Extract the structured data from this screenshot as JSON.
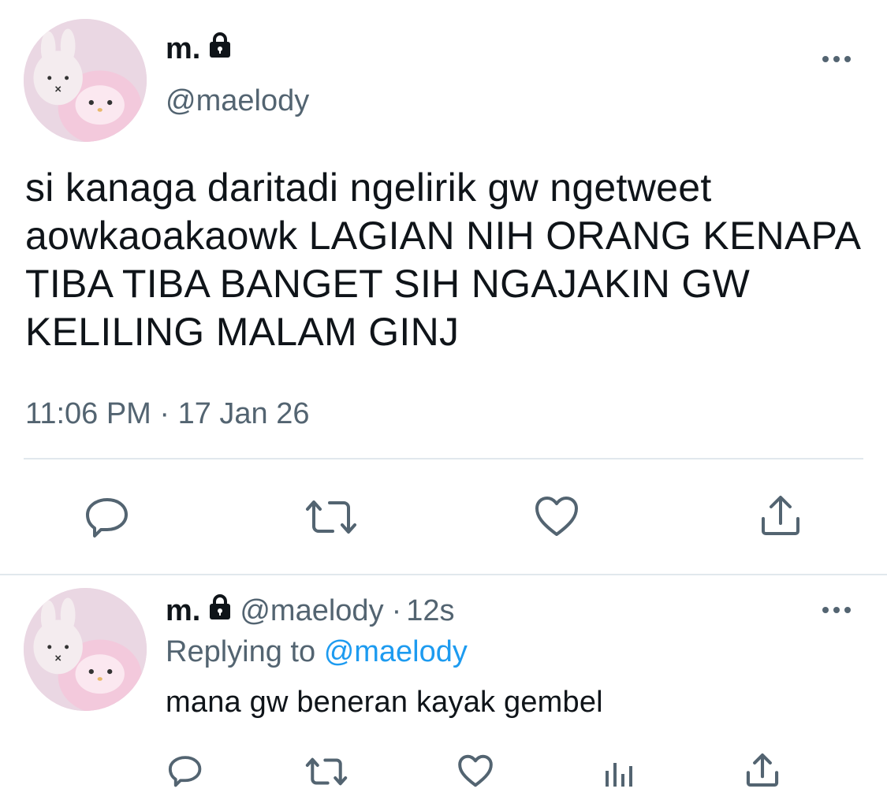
{
  "main_tweet": {
    "display_name": "m.",
    "handle": "@maelody",
    "text": "si kanaga daritadi ngelirik gw ngetweet aowkaoakaowk LAGIAN NIH ORANG KENAPA TIBA TIBA BANGET SIH NGAJAKIN GW KELILING MALAM GINJ",
    "timestamp": "11:06 PM · 17 Jan 26",
    "actions": [
      "reply-icon",
      "retweet-icon",
      "like-icon",
      "share-icon"
    ]
  },
  "reply_tweet": {
    "display_name": "m.",
    "handle": "@maelody",
    "separator": "·",
    "age": "12s",
    "replying_prefix": "Replying to",
    "replying_to": "@maelody",
    "text": "mana gw beneran kayak gembel",
    "actions": [
      "reply-icon",
      "retweet-icon",
      "like-icon",
      "analytics-icon",
      "share-icon"
    ]
  },
  "colors": {
    "text": "#0f1419",
    "muted": "#536471",
    "link": "#1d9bf0",
    "divider": "#e1e8ed"
  }
}
